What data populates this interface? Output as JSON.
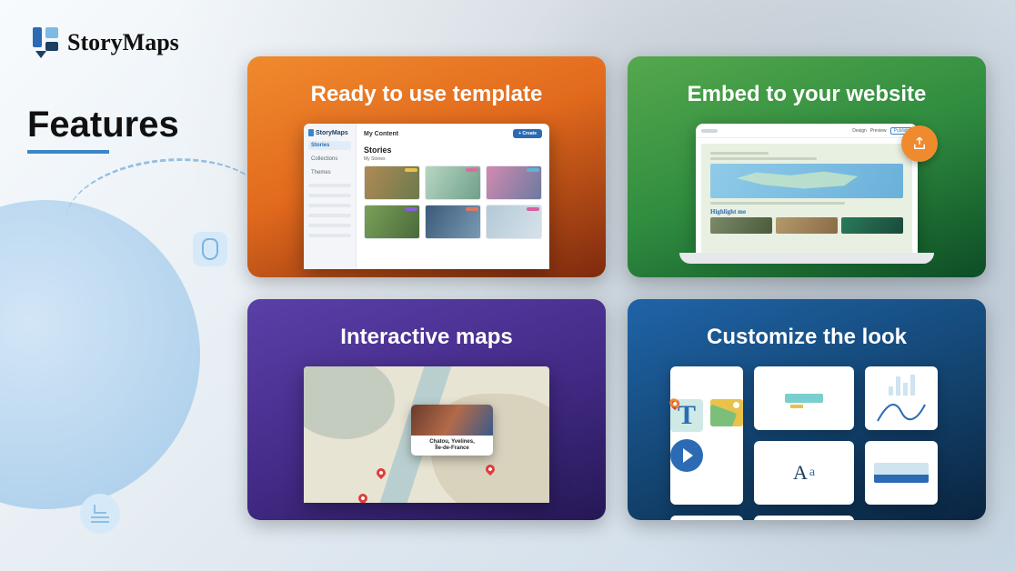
{
  "brand": {
    "name": "StoryMaps"
  },
  "heading": "Features",
  "cards": {
    "template": {
      "title": "Ready to use template"
    },
    "embed": {
      "title": "Embed to your website"
    },
    "maps": {
      "title": "Interactive maps"
    },
    "customize": {
      "title": "Customize the look"
    }
  },
  "template_dashboard": {
    "nav_header": "My Content",
    "sidebar": {
      "items": [
        "Stories",
        "Collections",
        "Themes"
      ]
    },
    "create_button": "+ Create",
    "section_title": "Stories",
    "section_sub": "My Stories"
  },
  "embed_preview": {
    "toolbar": {
      "items": [
        "Design",
        "Preview",
        "Publish"
      ]
    },
    "highlight_label": "Highlight me"
  },
  "map_popup": {
    "place": "Chatou, Yvelines,",
    "region": "Île-de-France"
  },
  "customize_tiles": {
    "font_sample_upper": "A",
    "font_sample_lower": "a",
    "text_glyph": "T"
  }
}
